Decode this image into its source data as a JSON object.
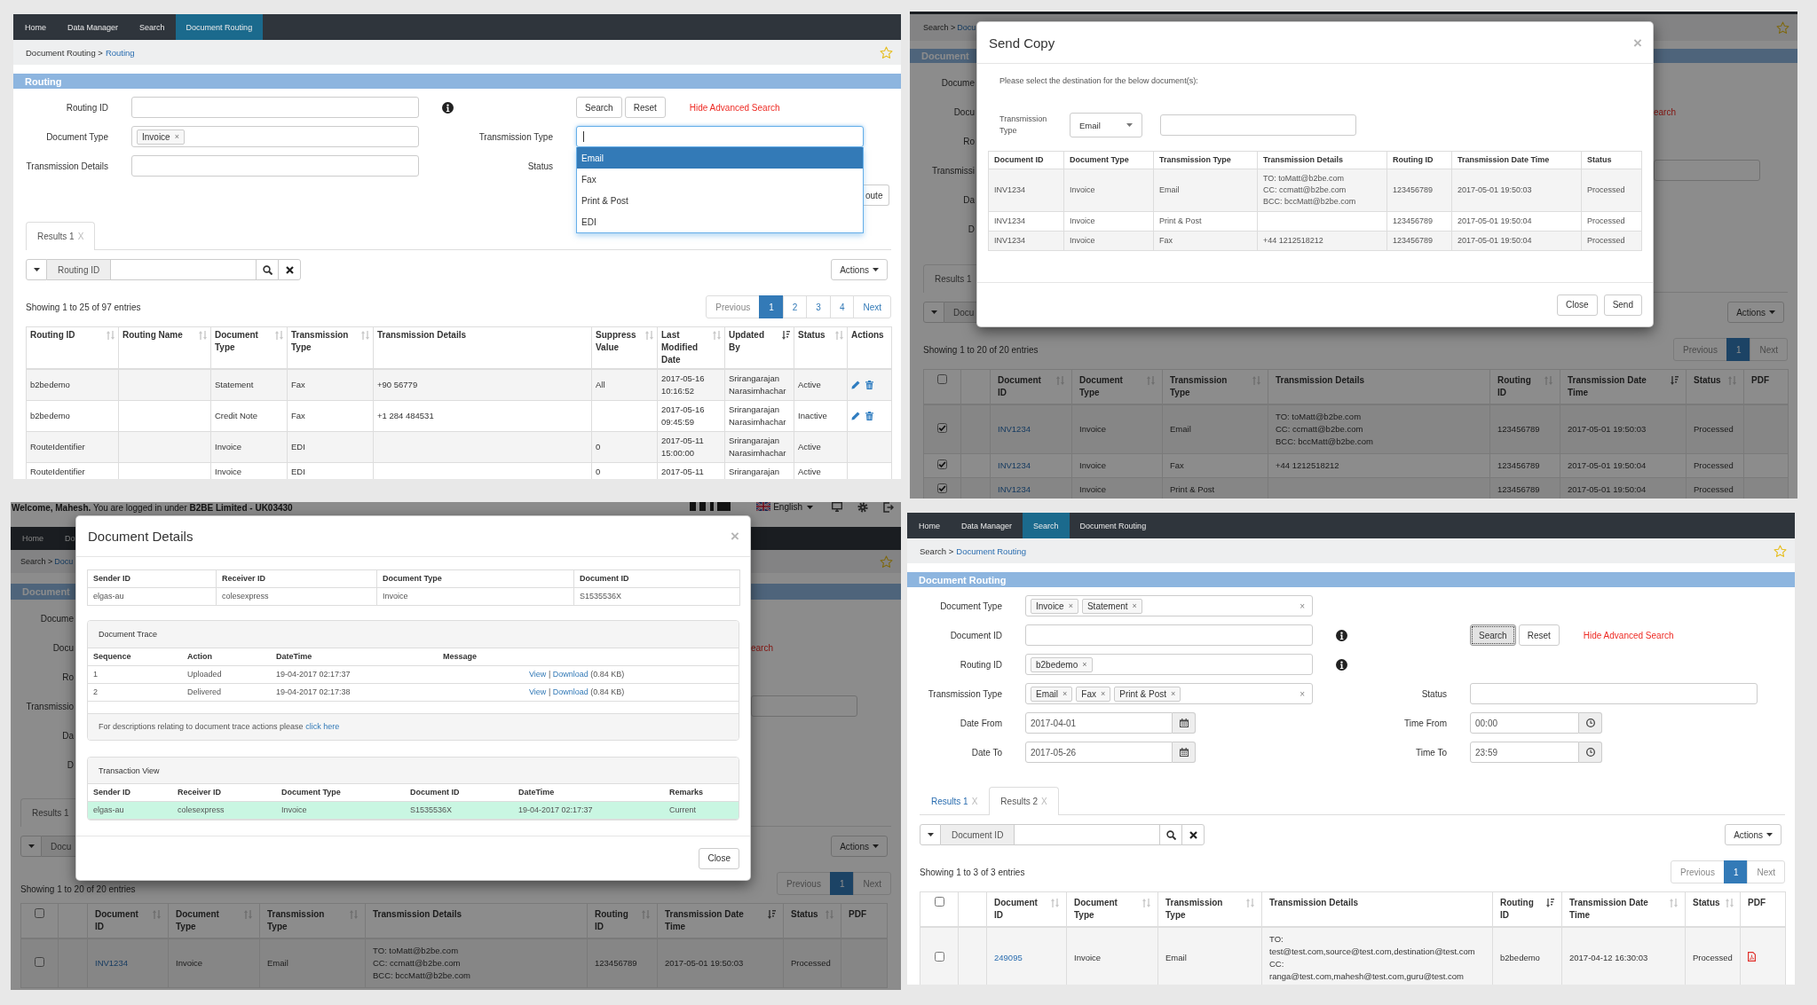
{
  "routing_screen": {
    "nav": [
      {
        "label": "Home",
        "selected": false
      },
      {
        "label": "Data Manager",
        "selected": false
      },
      {
        "label": "Search",
        "selected": false
      },
      {
        "label": "Document Routing",
        "selected": true
      }
    ],
    "breadcrumb": {
      "trail": "Document Routing >",
      "current": "Routing"
    },
    "section_title": "Routing",
    "form": {
      "routing_id": {
        "label": "Routing ID"
      },
      "buttons": [
        {
          "label": "Search",
          "focused": false
        },
        {
          "label": "Reset",
          "focused": false
        }
      ],
      "toggle_link": "Hide Advanced Search",
      "document_type": {
        "label": "Document Type",
        "tags": [
          {
            "label": "Invoice",
            "remove": "×"
          }
        ]
      },
      "transmission_type": {
        "label": "Transmission Type",
        "expanded": true,
        "options": [
          {
            "label": "Email",
            "selected": true
          },
          {
            "label": "Fax",
            "selected": false
          },
          {
            "label": "Print & Post",
            "selected": false
          },
          {
            "label": "EDI",
            "selected": false
          }
        ]
      },
      "transmission_details": {
        "label": "Transmission Details"
      },
      "status": {
        "label": "Status"
      },
      "partial_button": "oute"
    },
    "tabs": [
      {
        "label": "Results 1",
        "close": "X",
        "selected": true
      }
    ],
    "filter": {
      "field": "Routing ID"
    },
    "actions": "Actions",
    "info": "Showing 1 to 25 of 97 entries",
    "pagination": [
      {
        "label": "Previous",
        "selected": false,
        "disabled": true
      },
      {
        "label": "1",
        "selected": true,
        "disabled": false
      },
      {
        "label": "2",
        "selected": false,
        "disabled": false
      },
      {
        "label": "3",
        "selected": false,
        "disabled": false
      },
      {
        "label": "4",
        "selected": false,
        "disabled": false
      },
      {
        "label": "Next",
        "selected": false,
        "disabled": false
      }
    ],
    "table": {
      "columns": [
        {
          "label": "Routing ID",
          "sortable": true,
          "sorted": false
        },
        {
          "label": "Routing Name",
          "sortable": true,
          "sorted": false
        },
        {
          "label": "Document Type",
          "sortable": true,
          "sorted": false
        },
        {
          "label": "Transmission Type",
          "sortable": true,
          "sorted": false
        },
        {
          "label": "Transmission Details",
          "sortable": false
        },
        {
          "label": "Suppress Value",
          "sortable": true,
          "sorted": false
        },
        {
          "label": "Last Modified Date",
          "sortable": true,
          "sorted": false
        },
        {
          "label": "Updated By",
          "sortable": true,
          "sorted": true
        },
        {
          "label": "Status",
          "sortable": true,
          "sorted": false
        },
        {
          "label": "Actions",
          "sortable": false
        }
      ],
      "rows": [
        {
          "routing_id": "b2bedemo",
          "document_type": "Statement",
          "transmission_type": "Fax",
          "transmission_details": "+90 56779",
          "suppress_value": "All",
          "last_modified": "2017-05-16 10:16:52",
          "updated_by": "Srirangarajan Narasimhachar",
          "status": "Active",
          "actions": true
        },
        {
          "routing_id": "b2bedemo",
          "document_type": "Credit Note",
          "transmission_type": "Fax",
          "transmission_details": "+1 284 484531",
          "last_modified": "2017-05-16 09:45:59",
          "updated_by": "Srirangarajan Narasimhachar",
          "status": "Inactive",
          "actions": true
        },
        {
          "routing_id": "RouteIdentifier",
          "document_type": "Invoice",
          "transmission_type": "EDI",
          "suppress_value": "0",
          "last_modified": "2017-05-11 15:00:00",
          "updated_by": "Srirangarajan Narasimhachar",
          "status": "Active",
          "actions": false
        },
        {
          "routing_id": "RouteIdentifier",
          "document_type": "Invoice",
          "transmission_type": "EDI",
          "suppress_value": "0",
          "last_modified": "2017-05-11",
          "updated_by": "Srirangarajan",
          "status": "Active",
          "actions": false
        }
      ]
    }
  },
  "send_copy_screen": {
    "background": {
      "breadcrumb": {
        "trail": "Search >",
        "current": "Docu"
      },
      "section_title": "Document",
      "labels": [
        "Docume",
        "Docu",
        "Ro",
        "Transmissi",
        "Da",
        "D"
      ],
      "toggle_link": "earch",
      "tabs": [
        {
          "label": "Results 1",
          "selected": true
        }
      ],
      "filter": {
        "field": "Docu"
      },
      "actions": "Actions",
      "info": "Showing 1 to 20 of 20 entries",
      "pagination": [
        {
          "label": "Previous",
          "selected": false,
          "disabled": true
        },
        {
          "label": "1",
          "selected": true,
          "disabled": false
        },
        {
          "label": "Next",
          "selected": false,
          "disabled": true
        }
      ],
      "table": {
        "select_all": {
          "checked": false
        },
        "columns": [
          {
            "label": "Document ID",
            "sortable": true,
            "sorted": false
          },
          {
            "label": "Document Type",
            "sortable": true,
            "sorted": false
          },
          {
            "label": "Transmission Type",
            "sortable": true,
            "sorted": false
          },
          {
            "label": "Transmission Details",
            "sortable": false
          },
          {
            "label": "Routing ID",
            "sortable": true,
            "sorted": false
          },
          {
            "label": "Transmission Date Time",
            "sortable": true,
            "sorted": true
          },
          {
            "label": "Status",
            "sortable": true,
            "sorted": false
          },
          {
            "label": "PDF",
            "sortable": false
          }
        ],
        "rows": [
          {
            "checked": true,
            "document_id": "INV1234",
            "document_type": "Invoice",
            "transmission_type": "Email",
            "transmission_details": "TO: toMatt@b2be.com\nCC: ccmatt@b2be.com\nBCC: bccMatt@b2be.com",
            "routing_id": "123456789",
            "date_time": "2017-05-01 19:50:03",
            "status": "Processed"
          },
          {
            "checked": true,
            "document_id": "INV1234",
            "document_type": "Invoice",
            "transmission_type": "Fax",
            "transmission_details": "+44 1212518212",
            "routing_id": "123456789",
            "date_time": "2017-05-01 19:50:04",
            "status": "Processed"
          },
          {
            "checked": true,
            "document_id": "INV1234",
            "document_type": "Invoice",
            "transmission_type": "Print & Post",
            "routing_id": "123456789",
            "date_time": "2017-05-01 19:50:04",
            "status": "Processed"
          }
        ]
      }
    },
    "modal": {
      "title": "Send Copy",
      "close": "×",
      "instruction": "Please select the destination for the below document(s):",
      "transmission_type": {
        "label": "Transmission Type",
        "value": "Email"
      },
      "table": {
        "columns": [
          "Document ID",
          "Document Type",
          "Transmission Type",
          "Transmission Details",
          "Routing ID",
          "Transmission Date Time",
          "Status"
        ],
        "rows": [
          {
            "document_id": "INV1234",
            "document_type": "Invoice",
            "transmission_type": "Email",
            "transmission_details": "TO: toMatt@b2be.com\nCC: ccmatt@b2be.com\nBCC: bccMatt@b2be.com",
            "routing_id": "123456789",
            "date_time": "2017-05-01 19:50:03",
            "status": "Processed"
          },
          {
            "document_id": "INV1234",
            "document_type": "Invoice",
            "transmission_type": "Print & Post",
            "routing_id": "123456789",
            "date_time": "2017-05-01 19:50:04",
            "status": "Processed"
          },
          {
            "document_id": "INV1234",
            "document_type": "Invoice",
            "transmission_type": "Fax",
            "transmission_details": "+44 1212518212",
            "routing_id": "123456789",
            "date_time": "2017-05-01 19:50:04",
            "status": "Processed"
          }
        ]
      },
      "buttons": [
        "Close",
        "Send"
      ]
    }
  },
  "document_details_screen": {
    "background": {
      "welcome": "**Welcome, Mahesh.** You are logged in under **B2BE Limited - UK03430**",
      "language": "English",
      "nav": [
        {
          "label": "Home",
          "selected": false
        },
        {
          "label": "Do",
          "selected": false
        }
      ],
      "breadcrumb": {
        "trail": "Search >",
        "current": "Docu"
      },
      "section_title": "Document",
      "labels": [
        "Docume",
        "Docu",
        "Ro",
        "Transmissio",
        "Da",
        "D"
      ],
      "toggle_link": "earch",
      "tabs": [
        {
          "label": "Results 1",
          "selected": true
        }
      ],
      "filter": {
        "field": "Docu"
      },
      "actions": "Actions",
      "info": "Showing 1 to 20 of 20 entries",
      "pagination": [
        {
          "label": "Previous",
          "selected": false,
          "disabled": true
        },
        {
          "label": "1",
          "selected": true,
          "disabled": false
        },
        {
          "label": "Next",
          "selected": false,
          "disabled": true
        }
      ],
      "table": {
        "select_all": {
          "checked": false
        },
        "columns": [
          {
            "label": "Document ID",
            "sortable": true,
            "sorted": false
          },
          {
            "label": "Document Type",
            "sortable": true,
            "sorted": false
          },
          {
            "label": "Transmission Type",
            "sortable": true,
            "sorted": false
          },
          {
            "label": "Transmission Details",
            "sortable": false
          },
          {
            "label": "Routing ID",
            "sortable": true,
            "sorted": false
          },
          {
            "label": "Transmission Date Time",
            "sortable": true,
            "sorted": true
          },
          {
            "label": "Status",
            "sortable": true,
            "sorted": false
          },
          {
            "label": "PDF",
            "sortable": false
          }
        ],
        "rows": [
          {
            "checked": false,
            "document_id": "INV1234",
            "document_type": "Invoice",
            "transmission_type": "Email",
            "transmission_details": "TO: toMatt@b2be.com\nCC: ccmatt@b2be.com\nBCC: bccMatt@b2be.com",
            "routing_id": "123456789",
            "date_time": "2017-05-01 19:50:03",
            "status": "Processed"
          }
        ]
      }
    },
    "modal": {
      "title": "Document Details",
      "close": "×",
      "summary": {
        "columns": [
          "Sender ID",
          "Receiver ID",
          "Document Type",
          "Document ID"
        ],
        "values": [
          "elgas-au",
          "colesexpress",
          "Invoice",
          "S1535536X"
        ]
      },
      "trace": {
        "title": "Document Trace",
        "columns": [
          "Sequence",
          "Action",
          "DateTime",
          "Message"
        ],
        "rows": [
          {
            "sequence": "1",
            "action": "Uploaded",
            "date_time": "19-04-2017 02:17:37",
            "view": "View",
            "separator": "|",
            "download": "Download",
            "size": "(0.84 KB)"
          },
          {
            "sequence": "2",
            "action": "Delivered",
            "date_time": "19-04-2017 02:17:38",
            "view": "View",
            "separator": "|",
            "download": "Download",
            "size": "(0.84 KB)"
          }
        ],
        "note": {
          "text": "For descriptions relating to document trace actions please",
          "link": "click here"
        }
      },
      "transaction_view": {
        "title": "Transaction View",
        "columns": [
          "Sender ID",
          "Receiver ID",
          "Document Type",
          "Document ID",
          "DateTime",
          "Remarks"
        ],
        "rows": [
          {
            "highlighted": true,
            "cells": [
              "elgas-au",
              "colesexpress",
              "Invoice",
              "S1535536X",
              "19-04-2017 02:17:37",
              "Current"
            ]
          }
        ]
      },
      "buttons": [
        "Close"
      ]
    }
  },
  "document_routing_screen": {
    "nav": [
      {
        "label": "Home",
        "selected": false
      },
      {
        "label": "Data Manager",
        "selected": false
      },
      {
        "label": "Search",
        "selected": true
      },
      {
        "label": "Document Routing",
        "selected": false
      }
    ],
    "breadcrumb": {
      "trail": "Search >",
      "current": "Document Routing"
    },
    "section_title": "Document Routing",
    "form": {
      "document_type": {
        "label": "Document Type",
        "tags": [
          {
            "label": "Invoice",
            "remove": "×"
          },
          {
            "label": "Statement",
            "remove": "×"
          }
        ],
        "clear": "×"
      },
      "document_id": {
        "label": "Document ID"
      },
      "buttons": [
        {
          "label": "Search",
          "focused": true
        },
        {
          "label": "Reset",
          "focused": false
        }
      ],
      "toggle_link": "Hide Advanced Search",
      "routing_id": {
        "label": "Routing ID",
        "tags": [
          {
            "label": "b2bedemo",
            "remove": "×"
          }
        ]
      },
      "transmission_type": {
        "label": "Transmission Type",
        "tags": [
          {
            "label": "Email",
            "remove": "×"
          },
          {
            "label": "Fax",
            "remove": "×"
          },
          {
            "label": "Print & Post",
            "remove": "×"
          }
        ],
        "clear": "×"
      },
      "status": {
        "label": "Status"
      },
      "date_from": {
        "label": "Date From",
        "value": "2017-04-01"
      },
      "time_from": {
        "label": "Time From",
        "value": "00:00"
      },
      "date_to": {
        "label": "Date To",
        "value": "2017-05-26"
      },
      "time_to": {
        "label": "Time To",
        "value": "23:59"
      }
    },
    "tabs": [
      {
        "label": "Results 1",
        "close": "X",
        "selected": false
      },
      {
        "label": "Results 2",
        "close": "X",
        "selected": true
      }
    ],
    "filter": {
      "field": "Document ID"
    },
    "actions": "Actions",
    "info": "Showing 1 to 3 of 3 entries",
    "pagination": [
      {
        "label": "Previous",
        "selected": false,
        "disabled": true
      },
      {
        "label": "1",
        "selected": true,
        "disabled": false
      },
      {
        "label": "Next",
        "selected": false,
        "disabled": true
      }
    ],
    "table": {
      "select_all": {
        "checked": false
      },
      "columns": [
        {
          "label": "Document ID",
          "sortable": true,
          "sorted": false
        },
        {
          "label": "Document Type",
          "sortable": true,
          "sorted": false
        },
        {
          "label": "Transmission Type",
          "sortable": true,
          "sorted": false
        },
        {
          "label": "Transmission Details",
          "sortable": false
        },
        {
          "label": "Routing ID",
          "sortable": true,
          "sorted": true
        },
        {
          "label": "Transmission Date Time",
          "sortable": true,
          "sorted": false
        },
        {
          "label": "Status",
          "sortable": true,
          "sorted": false
        },
        {
          "label": "PDF",
          "sortable": false
        }
      ],
      "rows": [
        {
          "checked": false,
          "document_id": "249095",
          "document_type": "Invoice",
          "transmission_type": "Email",
          "transmission_details": "TO:\ntest@test.com,source@test.com,destination@test.com\nCC:\nranga@test.com,mahesh@test.com,guru@test.com",
          "routing_id": "b2bedemo",
          "date_time": "2017-04-12 16:30:03",
          "status": "Processed",
          "pdf": true
        }
      ]
    }
  }
}
